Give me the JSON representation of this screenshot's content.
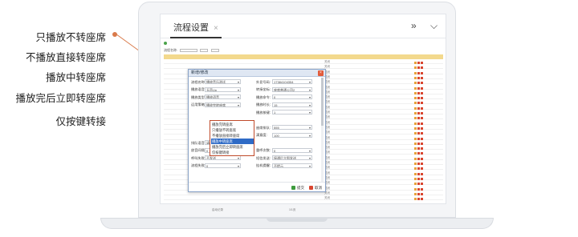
{
  "callouts": [
    {
      "label": "只播放不转座席"
    },
    {
      "label": "不播放直接转座席"
    },
    {
      "label": "播放中转座席"
    },
    {
      "label": "播放完后立即转座席"
    },
    {
      "label": "仅按键转接"
    }
  ],
  "colors": {
    "accent": "#d97a4a",
    "header_row": "#f3d98d",
    "selected": "#2f6bc6",
    "dropdown_border": "#c04a2a"
  },
  "app": {
    "tab_label": "流程设置",
    "tab_close": "×",
    "header_icons": [
      "double-chevron-right-icon",
      "chevron-down-icon"
    ],
    "header_icon_glyphs": [
      "»",
      "⌵"
    ]
  },
  "modal": {
    "title": "新增/修改",
    "fields": [
      {
        "label": "流程名称:",
        "value": "播放音乐测试"
      },
      {
        "label": "外显号码:",
        "value": "17384104354"
      },
      {
        "label": "播放语音:",
        "value": "无声Up"
      },
      {
        "label": "转接坐标:",
        "value": "座席普通公司2"
      },
      {
        "label": "播放类型:",
        "value": "播放语音"
      },
      {
        "label": "播放命令:",
        "value": "0"
      },
      {
        "label": "运用策略:",
        "value": "播放完转座席"
      },
      {
        "label": "播放时长:",
        "value": "15"
      },
      {
        "label": "播放按键:",
        "value": "1"
      },
      {
        "label": "座席排队:",
        "value": "555"
      },
      {
        "label": "满意度:",
        "value": "100"
      },
      {
        "label": "排队语音:",
        "value": "请通告语音"
      },
      {
        "label": "放音间隔:",
        "value": "0"
      },
      {
        "label": "重呼次数:",
        "value": "0"
      },
      {
        "label": "呼叫失败:",
        "value": "不发送"
      },
      {
        "label": "短信发送:",
        "value": "接通后立即发送"
      },
      {
        "label": "流程失败:",
        "value": "0"
      },
      {
        "label": "挂机提醒:",
        "value": "不提示"
      }
    ],
    "submit_label": "提交",
    "cancel_label": "取消"
  },
  "dropdown": {
    "options": [
      {
        "label": "播放完转座席",
        "selected": false
      },
      {
        "label": "只播放不转座席",
        "selected": false
      },
      {
        "label": "不播放直接转座席",
        "selected": false
      },
      {
        "label": "播放中转座席",
        "selected": true
      },
      {
        "label": "播放完后立即转座席",
        "selected": false
      },
      {
        "label": "仅按键转接",
        "selected": false
      }
    ]
  },
  "mini_page": {
    "filter_label": "流程名称:",
    "search_label": "查询",
    "reset_label": "重置",
    "footer_left": "启动记录",
    "footer_mid": "1/1页",
    "row_status": "关闭",
    "row_actions": [
      "编辑",
      "删除",
      "复制"
    ]
  }
}
